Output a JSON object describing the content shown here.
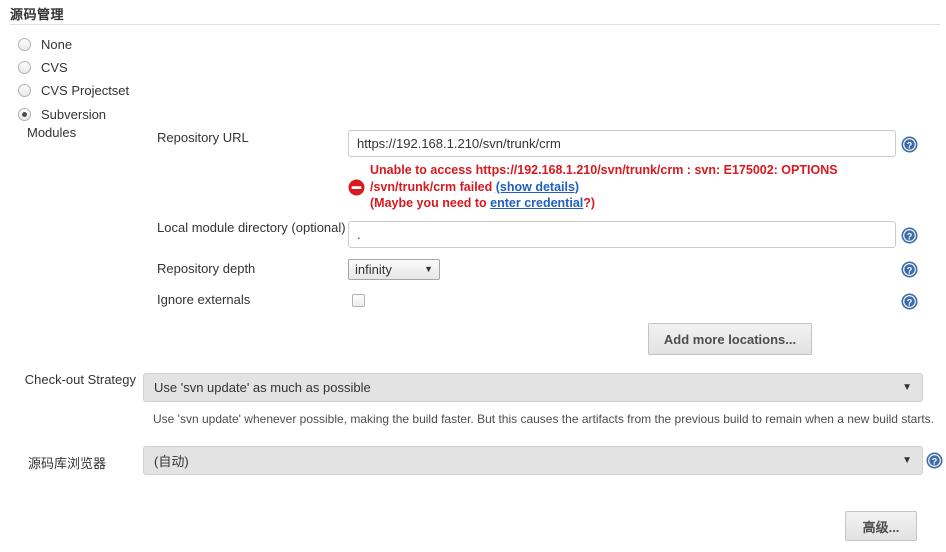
{
  "section": {
    "title": "源码管理"
  },
  "scm_options": [
    {
      "label": "None",
      "selected": false
    },
    {
      "label": "CVS",
      "selected": false
    },
    {
      "label": "CVS Projectset",
      "selected": false
    },
    {
      "label": "Subversion",
      "selected": true
    }
  ],
  "modules": {
    "label": "Modules",
    "repository_url": {
      "label": "Repository URL",
      "value": "https://192.168.1.210/svn/trunk/crm"
    },
    "error": {
      "line1_prefix": "Unable to access https://192.168.1.210/svn/trunk/crm : svn: E175002: OPTIONS",
      "line2_prefix": "/svn/trunk/crm failed ",
      "show_details_link": "(show details)",
      "line3_prefix": "(Maybe you need to ",
      "credential_link": "enter credential",
      "line3_suffix": "?)",
      "color": "#d9181f",
      "link_color": "#1f5fbf"
    },
    "local_module_directory": {
      "label": "Local module directory (optional)",
      "value": "."
    },
    "repository_depth": {
      "label": "Repository depth",
      "value": "infinity"
    },
    "ignore_externals": {
      "label": "Ignore externals",
      "checked": false
    },
    "add_more_locations_button": "Add more locations..."
  },
  "checkout_strategy": {
    "label": "Check-out Strategy",
    "value": "Use 'svn update' as much as possible",
    "description": "Use 'svn update' whenever possible, making the build faster. But this causes the artifacts from the previous build to remain when a new build starts."
  },
  "repository_browser": {
    "label": "源码库浏览器",
    "value": "(自动)"
  },
  "advanced_button": "高级...",
  "icons": {
    "help": "help-icon",
    "error": "error-icon",
    "caret": "▼"
  }
}
